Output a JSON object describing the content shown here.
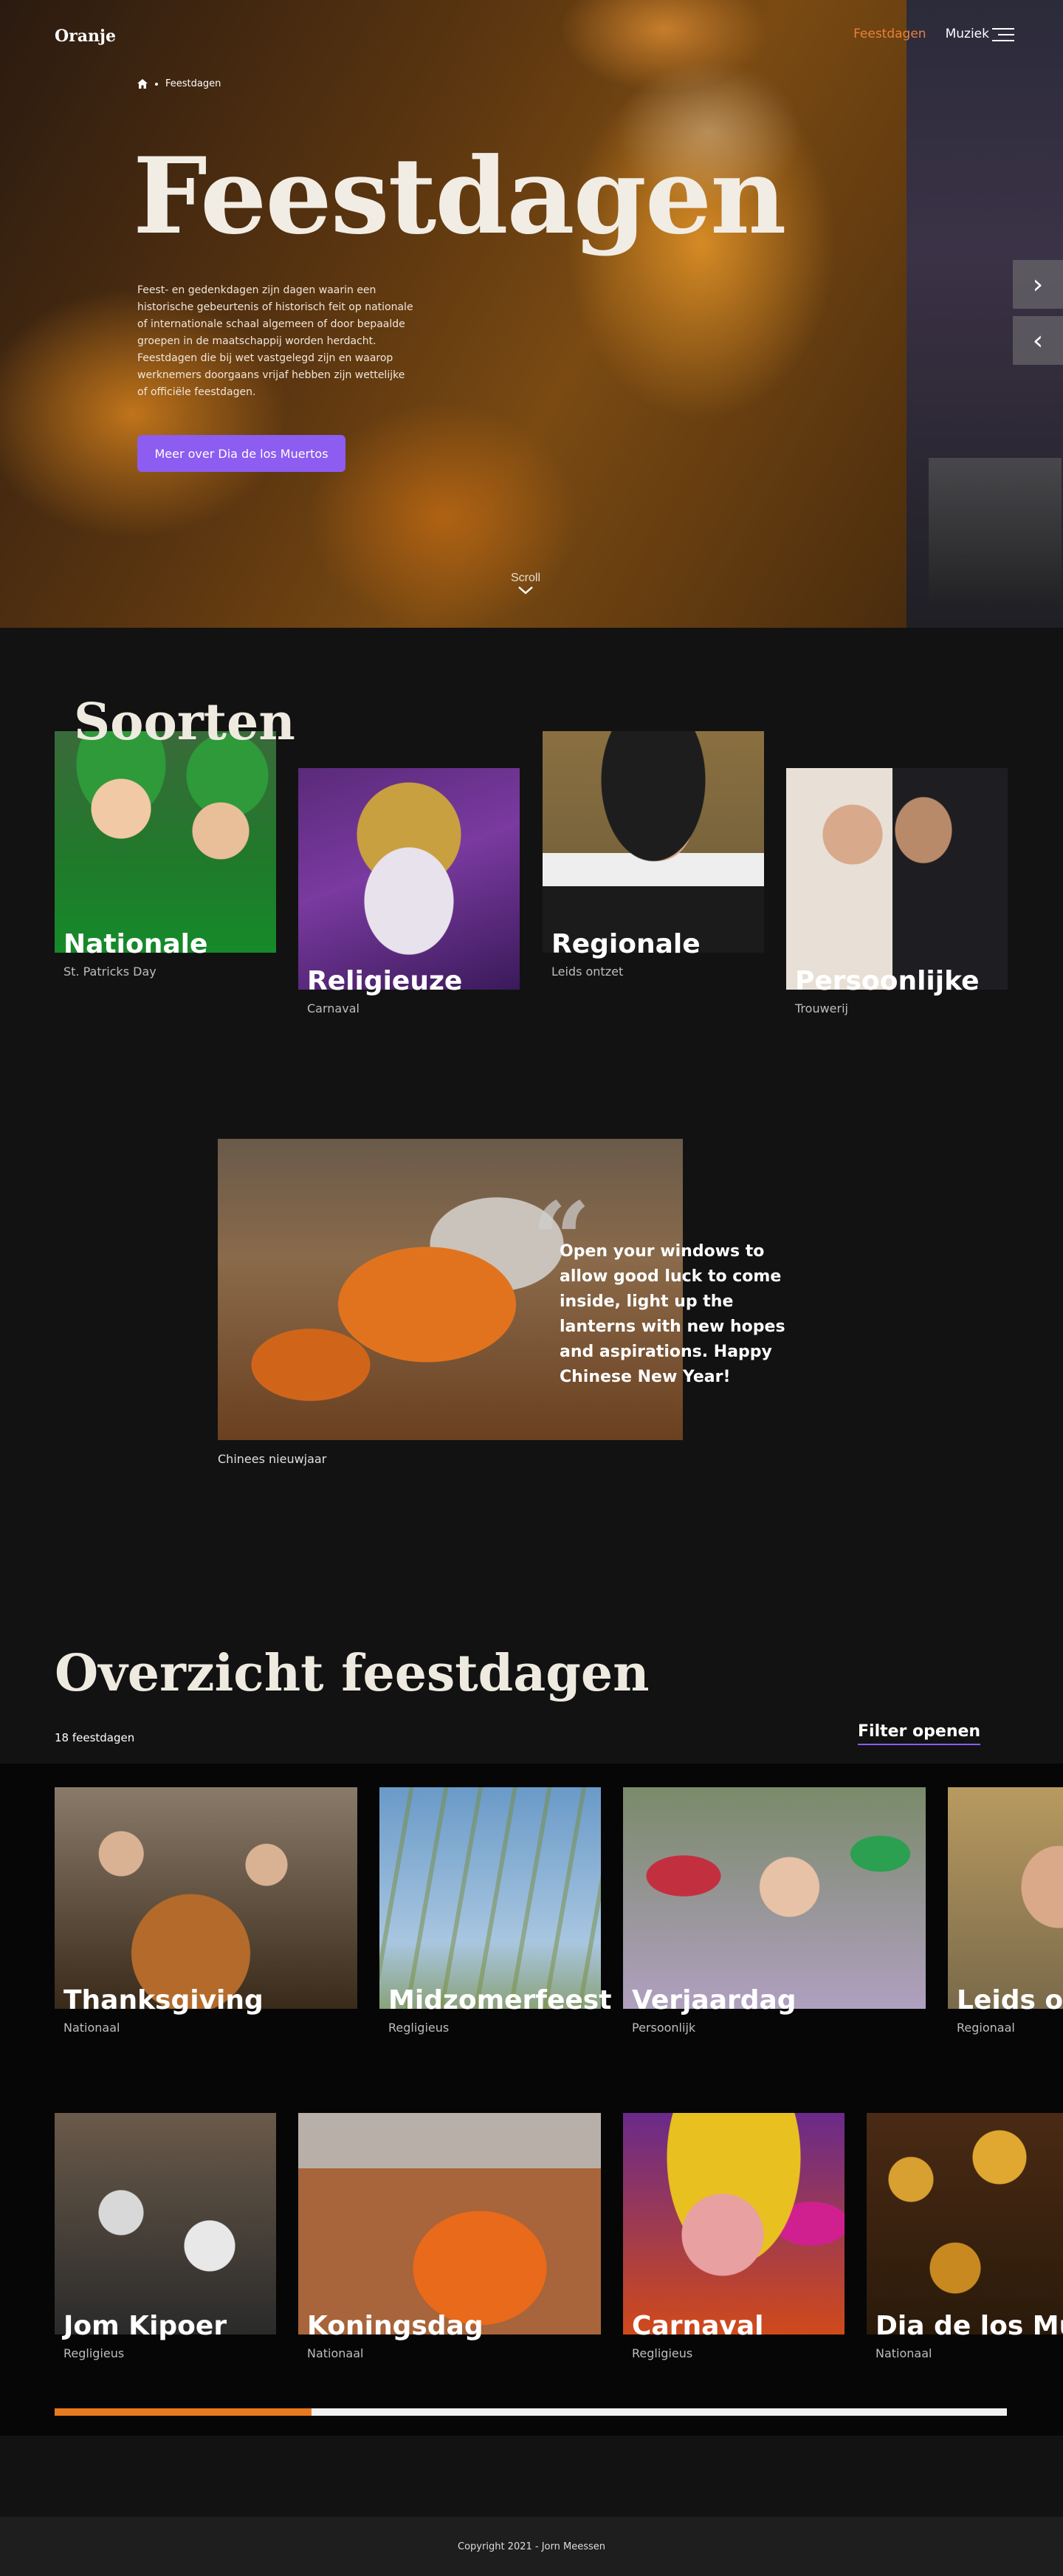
{
  "header": {
    "logo": "Oranje",
    "nav": [
      {
        "label": "Feestdagen",
        "active": true
      },
      {
        "label": "Muziek",
        "active": false
      }
    ],
    "menu_icon": "hamburger-icon"
  },
  "hero": {
    "breadcrumb": {
      "home_icon": "home-icon",
      "current": "Feestdagen"
    },
    "title": "Feestdagen",
    "description": "Feest- en gedenkdagen zijn dagen waarin een historische gebeurtenis of historisch feit op nationale of internationale schaal algemeen of door bepaalde groepen in de maatschappij worden herdacht. Feestdagen die bij wet vastgelegd zijn en waarop werknemers doorgaans vrijaf hebben zijn wettelijke of officiële feestdagen.",
    "button": "Meer over Dia de los Muertos",
    "next_icon": "chevron-right-icon",
    "prev_icon": "chevron-left-icon",
    "scroll_label": "Scroll",
    "scroll_icon": "chevron-down-icon"
  },
  "soorten": {
    "title": "Soorten",
    "cards": [
      {
        "name": "Nationale",
        "example": "St. Patricks Day"
      },
      {
        "name": "Religieuze",
        "example": "Carnaval"
      },
      {
        "name": "Regionale",
        "example": "Leids ontzet"
      },
      {
        "name": "Persoonlijke",
        "example": "Trouwerij"
      }
    ]
  },
  "featured": {
    "quote": "Open your windows to allow good luck to come inside, light up the lanterns with new hopes and aspirations. Happy Chinese New Year!",
    "caption": "Chinees nieuwjaar",
    "quote_icon": "quote-mark-icon"
  },
  "overzicht": {
    "title": "Overzicht feestdagen",
    "count": "18 feestdagen",
    "filter": "Filter openen",
    "row1": [
      {
        "name": "Thanksgiving",
        "type": "Nationaal"
      },
      {
        "name": "Midzomerfeest",
        "type": "Regligieus"
      },
      {
        "name": "Verjaardag",
        "type": "Persoonlijk"
      },
      {
        "name": "Leids ontzet",
        "type": "Regionaal"
      }
    ],
    "row2": [
      {
        "name": "Jom Kipoer",
        "type": "Regligieus"
      },
      {
        "name": "Koningsdag",
        "type": "Nationaal"
      },
      {
        "name": "Carnaval",
        "type": "Regligieus"
      },
      {
        "name": "Dia de los Muertos",
        "type": "Nationaal"
      }
    ],
    "scroll_progress": 0.27,
    "colors": {
      "progress_fill": "#e87a1e",
      "progress_track": "#f0f0f0",
      "accent": "#8d5cf0",
      "nav_active": "#e8823a"
    }
  },
  "footer": {
    "copyright": "Copyright 2021 - Jorn Meessen"
  }
}
